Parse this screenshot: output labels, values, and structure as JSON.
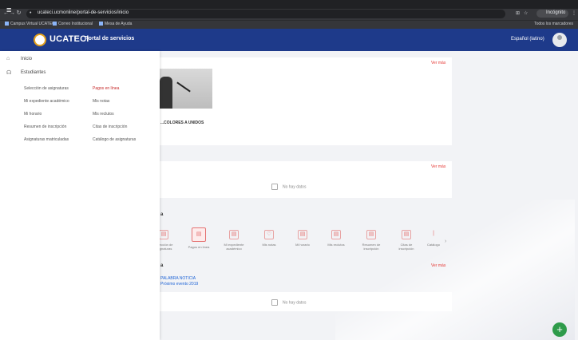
{
  "browser": {
    "url": "ucateci.ucmonline/portal-de-servicios/inicio",
    "bookmarks": [
      "Campus Virtual UCATECI",
      "Correo Institucional",
      "Mesa de Ayuda"
    ],
    "bookmarks_right": "Todos los marcadores",
    "profile_label": "Incógnito"
  },
  "header": {
    "logo": "UCATECI",
    "portal_title": "Portal de servicios",
    "language": "Español (latino)"
  },
  "sidebar": {
    "home": "Inicio",
    "section": "Estudiantes",
    "links_left": [
      "Selección de asignaturas",
      "Mi expediente académico",
      "Mi horario",
      "Resumen de inscripción",
      "Asignaturas matriculadas"
    ],
    "links_right": [
      "Pagos en línea",
      "Mis notas",
      "Mis reclutos",
      "Citas de inscripción",
      "Catálogo de asignaturas"
    ]
  },
  "main": {
    "see_all": "Ver más",
    "news_title": "...COLORES A UNIDOS",
    "empty_text": "No hay datos",
    "section_letters": [
      "a",
      "a"
    ],
    "tiles": [
      "Selección de asignaturas",
      "Pagos en línea",
      "Mi expediente académico",
      "Mis notas",
      "Mi horario",
      "Mis reclutos",
      "Resumen de inscripción",
      "Citas de inscripción",
      "Catálogo"
    ],
    "link_lines": [
      "PALABRA NOTICIA",
      "Próximo evento 2019"
    ]
  },
  "fab_label": "+",
  "colors": {
    "brand": "#1e3a8a",
    "accent": "#e53935",
    "fab": "#2e9b4a"
  }
}
